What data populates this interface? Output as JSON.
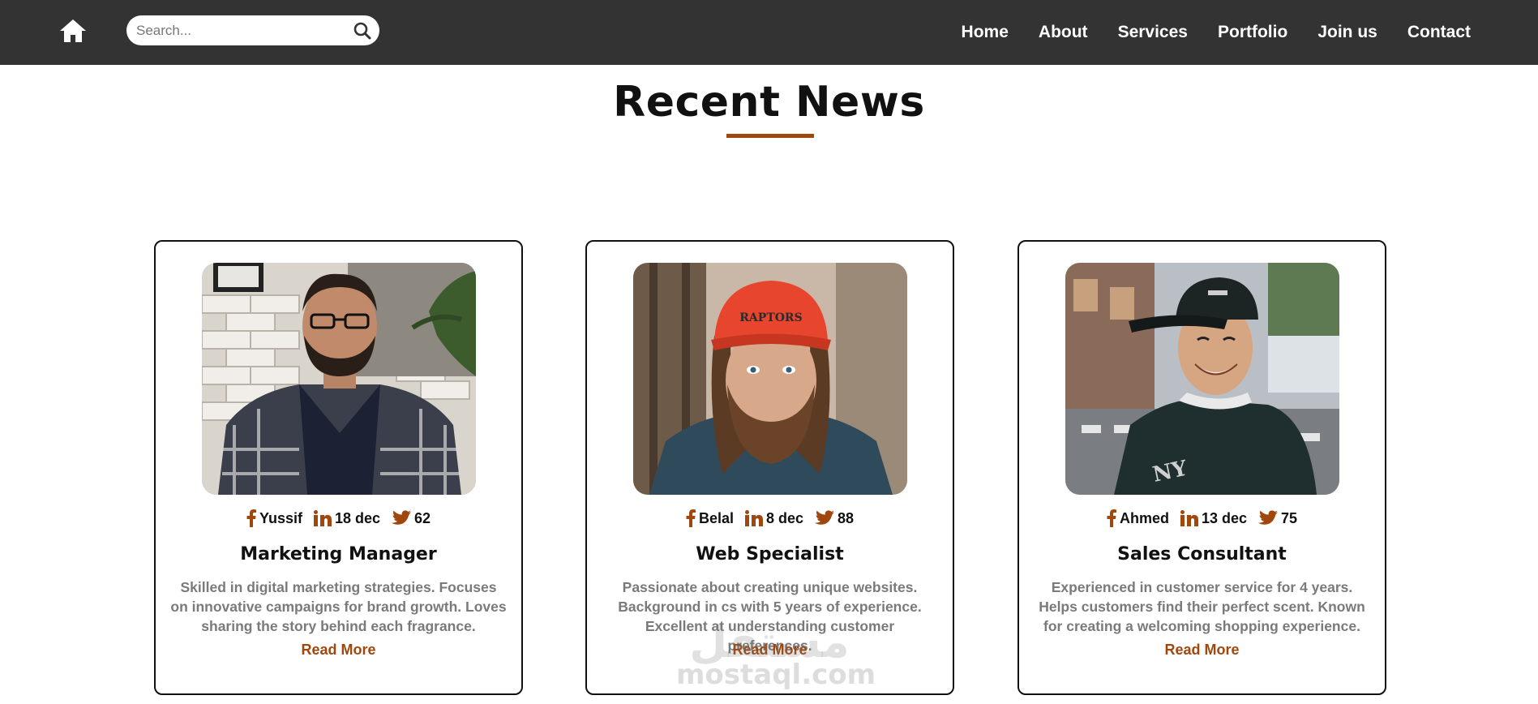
{
  "colors": {
    "header_bg": "#333333",
    "accent": "#a0470d",
    "text_dark": "#111111",
    "text_muted": "#7a7a7a"
  },
  "header": {
    "home_icon": "home-icon",
    "search": {
      "placeholder": "Search...",
      "value": "",
      "icon": "search-icon"
    },
    "nav": [
      "Home",
      "About",
      "Services",
      "Portfolio",
      "Join us",
      "Contact"
    ]
  },
  "section": {
    "title": "Recent News"
  },
  "cards": [
    {
      "author": "Yussif",
      "date": "18 dec",
      "tweets": "62",
      "role": "Marketing Manager",
      "description": "Skilled in digital marketing strategies. Focuses on innovative campaigns for brand growth. Loves sharing the story behind each fragrance.",
      "read_more": "Read More"
    },
    {
      "author": "Belal",
      "date": "8 dec",
      "tweets": "88",
      "role": "Web Specialist",
      "description": "Passionate about creating unique websites. Background in cs with 5 years of experience. Excellent at understanding customer preferences.",
      "read_more": "Read More"
    },
    {
      "author": "Ahmed",
      "date": "13 dec",
      "tweets": "75",
      "role": "Sales Consultant",
      "description": "Experienced in customer service for 4 years. Helps customers find their perfect scent. Known for creating a welcoming shopping experience.",
      "read_more": "Read More"
    }
  ],
  "watermark": {
    "arabic": "مستقل",
    "latin": "mostaql.com"
  }
}
